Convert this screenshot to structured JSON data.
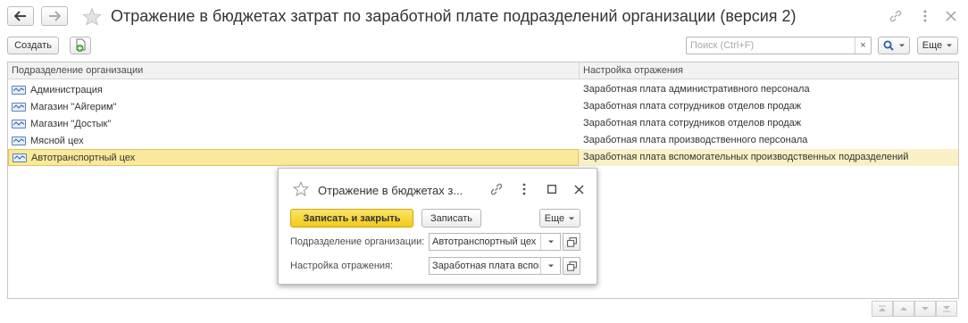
{
  "window": {
    "title": "Отражение в бюджетах затрат по заработной плате подразделений организации (версия 2)"
  },
  "toolbar": {
    "create_label": "Создать",
    "search_placeholder": "Поиск (Ctrl+F)",
    "search_clear": "×",
    "more_label": "Еще"
  },
  "table": {
    "columns": [
      "Подразделение организации",
      "Настройка отражения"
    ],
    "rows": [
      {
        "department": "Администрация",
        "setting": "Заработная плата административного персонала"
      },
      {
        "department": "Магазин \"Айгерим\"",
        "setting": "Заработная плата сотрудников отделов продаж"
      },
      {
        "department": "Магазин \"Достык\"",
        "setting": "Заработная плата сотрудников отделов продаж"
      },
      {
        "department": "Мясной цех",
        "setting": "Заработная плата производственного персонала"
      },
      {
        "department": "Автотранспортный цех",
        "setting": "Заработная плата вспомогательных производственных подразделений"
      }
    ],
    "selected_row": 4
  },
  "dialog": {
    "title": "Отражение в бюджетах з...",
    "save_close_label": "Записать и закрыть",
    "save_label": "Записать",
    "more_label": "Еще",
    "department_label": "Подразделение организации:",
    "department_value": "Автотранспортный цех",
    "setting_label": "Настройка отражения:",
    "setting_value": "Заработная плата вспом"
  },
  "colors": {
    "selected_row": "#fbe99b",
    "primary_button": "#f6d420",
    "icon_gray": "#999999"
  }
}
